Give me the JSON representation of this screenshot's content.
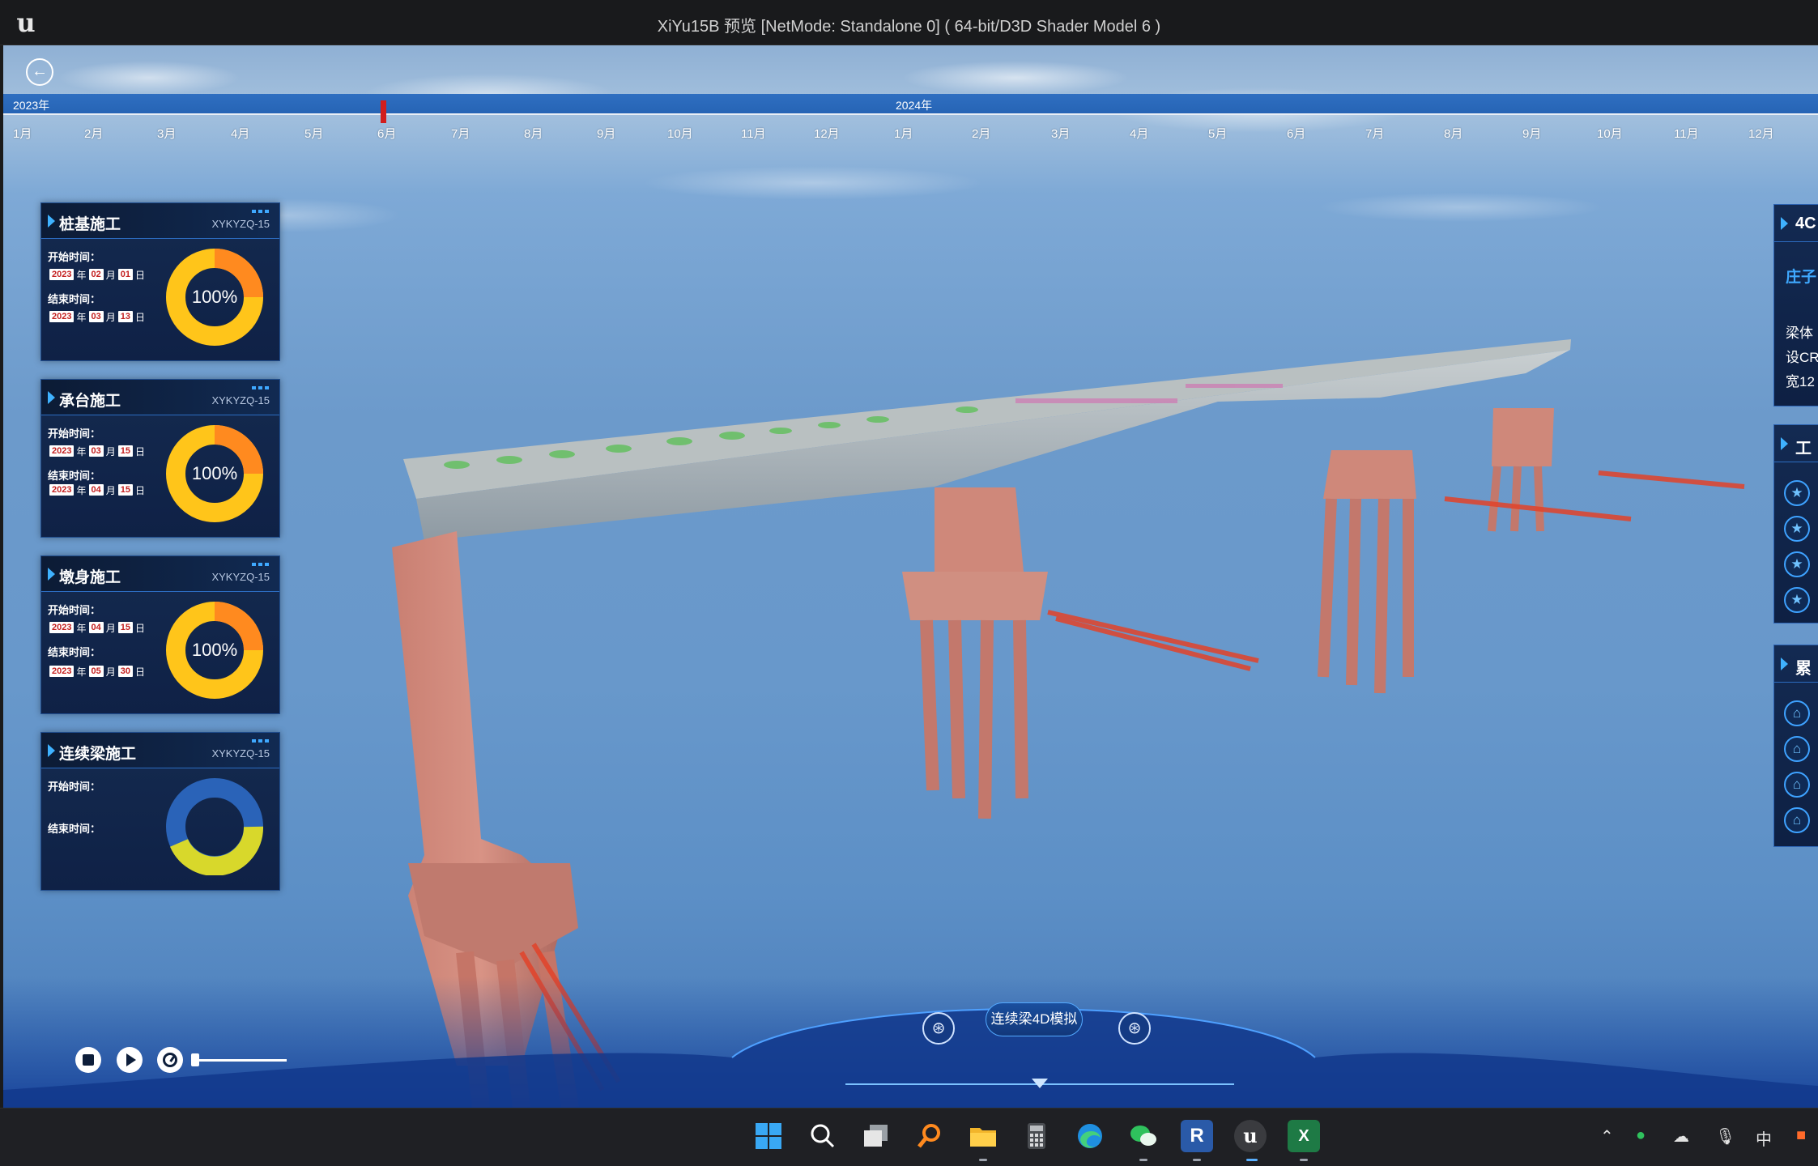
{
  "window": {
    "title": "XiYu15B 预览 [NetMode: Standalone 0]   ( 64-bit/D3D Shader Model 6 )",
    "logo_glyph": "u"
  },
  "nav": {
    "back_glyph": "←"
  },
  "timeline": {
    "year_a": "2023年",
    "year_b": "2024年",
    "months_a": [
      "1月",
      "2月",
      "3月",
      "4月",
      "5月",
      "6月",
      "7月",
      "8月",
      "9月",
      "10月",
      "11月",
      "12月"
    ],
    "months_b": [
      "1月",
      "2月",
      "3月",
      "4月",
      "5月",
      "6月",
      "7月",
      "8月",
      "9月",
      "10月",
      "11月",
      "12月"
    ]
  },
  "panels": [
    {
      "title": "桩基施工",
      "code": "XYKYZQ-15",
      "start_label": "开始时间：",
      "end_label": "结束时间：",
      "start": {
        "year": "2023",
        "month": "02",
        "day": "01"
      },
      "end": {
        "year": "2023",
        "month": "03",
        "day": "13"
      },
      "percent_text": "100%",
      "progress": 1.0
    },
    {
      "title": "承台施工",
      "code": "XYKYZQ-15",
      "start_label": "开始时间：",
      "end_label": "结束时间：",
      "start": {
        "year": "2023",
        "month": "03",
        "day": "15"
      },
      "end": {
        "year": "2023",
        "month": "04",
        "day": "15"
      },
      "percent_text": "100%",
      "progress": 1.0
    },
    {
      "title": "墩身施工",
      "code": "XYKYZQ-15",
      "start_label": "开始时间：",
      "end_label": "结束时间：",
      "start": {
        "year": "2023",
        "month": "04",
        "day": "15"
      },
      "end": {
        "year": "2023",
        "month": "05",
        "day": "30"
      },
      "percent_text": "100%",
      "progress": 1.0
    },
    {
      "title": "连续梁施工",
      "code": "XYKYZQ-15",
      "start_label": "开始时间：",
      "end_label": "结束时间：",
      "percent_text": "",
      "progress": 0.0
    }
  ],
  "date_units": {
    "year": "年",
    "month": "月",
    "day": "日"
  },
  "right_panels": {
    "top": {
      "title": "4C",
      "lines": [
        "庄子",
        "梁体",
        "设CR",
        "宽12"
      ]
    },
    "middle": {
      "title": "工"
    },
    "bottom": {
      "title": "累"
    }
  },
  "hud": {
    "center_label": "连续梁4D模拟",
    "left_icon": "⊛",
    "right_icon": "⊛"
  },
  "taskbar": {
    "ime_label": "中"
  },
  "colors": {
    "accent_blue": "#2f6fc1",
    "donut_orange": "#ff8a1f",
    "donut_yellow": "#ffc51a",
    "donut_blue": "#2a63b8",
    "donut_lime": "#d8d82b",
    "marker_red": "#d21e1e"
  }
}
